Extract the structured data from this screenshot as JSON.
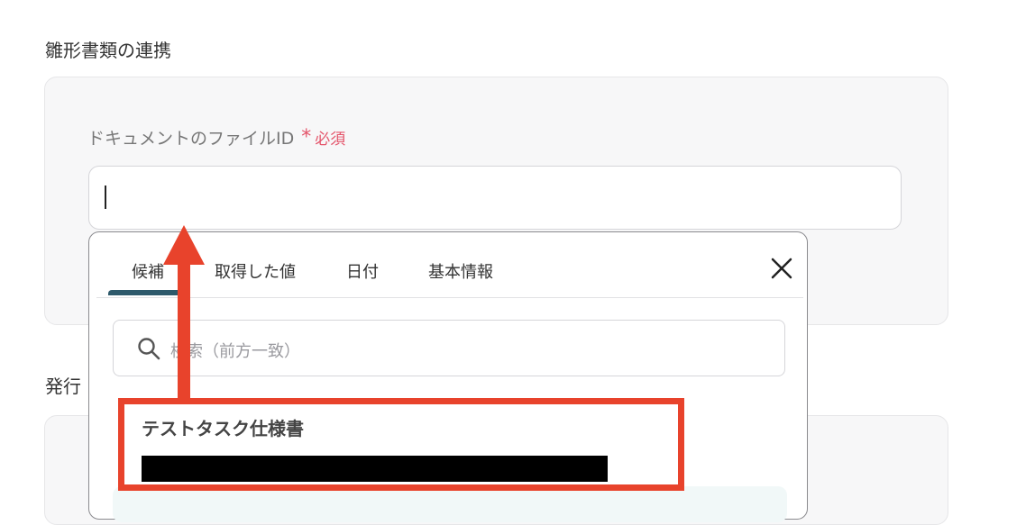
{
  "section1": {
    "title": "雛形書類の連携"
  },
  "section2": {
    "title": "発行"
  },
  "field": {
    "label": "ドキュメントのファイルID",
    "required_mark": "*",
    "required_text": "必須",
    "value": ""
  },
  "dropdown": {
    "tabs": [
      {
        "label": "候補",
        "active": true
      },
      {
        "label": "取得した値"
      },
      {
        "label": "日付"
      },
      {
        "label": "基本情報"
      }
    ],
    "close_icon": "close-icon",
    "search": {
      "placeholder": "検索（前方一致）",
      "icon": "search-icon"
    },
    "options": [
      {
        "title": "テストタスク仕様書",
        "subtitle_redacted": true
      }
    ]
  },
  "colors": {
    "accent_tab": "#2e5a6b",
    "required": "#e4556b",
    "annotation": "#e8432c",
    "card_bg": "#f7f7f8"
  }
}
